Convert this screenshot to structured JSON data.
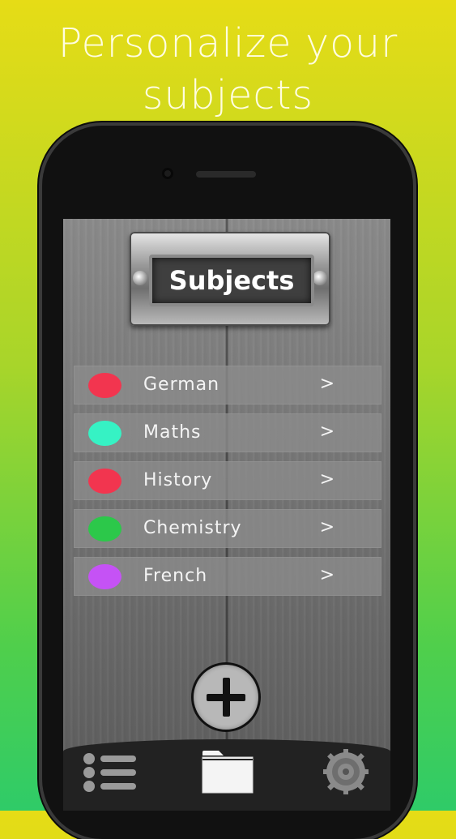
{
  "headline": "Personalize your subjects",
  "header": {
    "title": "Subjects"
  },
  "subjects": [
    {
      "name": "German",
      "color": "#f2354f",
      "chevron": ">"
    },
    {
      "name": "Maths",
      "color": "#36f2c4",
      "chevron": ">"
    },
    {
      "name": "History",
      "color": "#f2354f",
      "chevron": ">"
    },
    {
      "name": "Chemistry",
      "color": "#2cc84a",
      "chevron": ">"
    },
    {
      "name": "French",
      "color": "#c552f5",
      "chevron": ">"
    }
  ],
  "add_button": {
    "icon": "plus-icon"
  },
  "tabbar": {
    "tabs": [
      {
        "icon": "list-icon"
      },
      {
        "icon": "folder-icon",
        "active": true
      },
      {
        "icon": "gear-icon"
      }
    ]
  }
}
